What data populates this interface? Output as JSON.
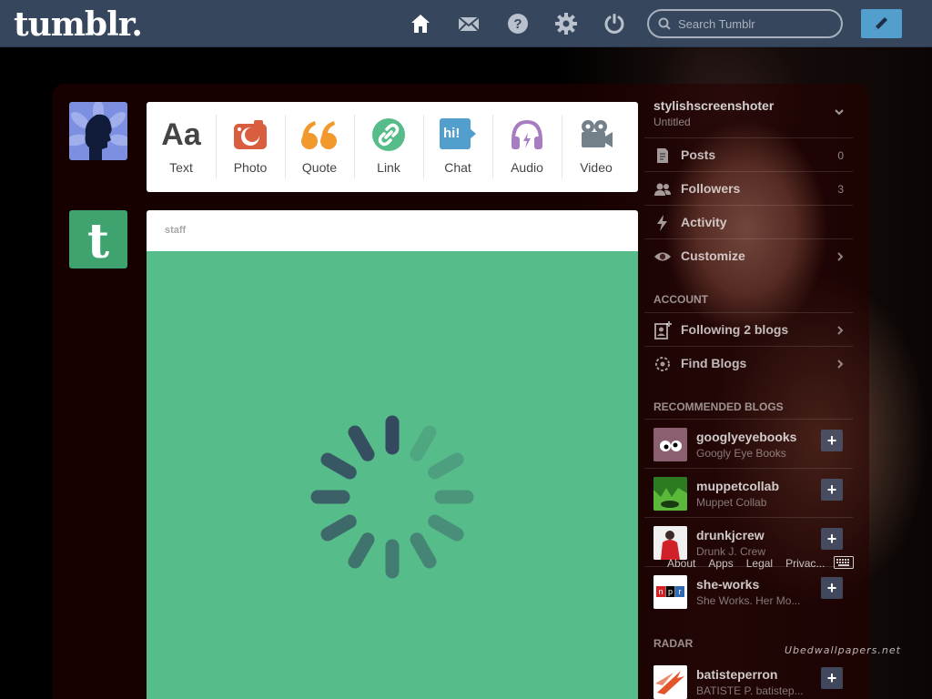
{
  "header": {
    "logo": "tumblr.",
    "search_placeholder": "Search Tumblr",
    "nav_icons": [
      "home-icon",
      "mail-icon",
      "help-icon",
      "settings-icon",
      "power-icon"
    ],
    "compose_icon": "pencil-icon"
  },
  "post_types": [
    {
      "label": "Text",
      "icon": "text-icon",
      "color": "#444444"
    },
    {
      "label": "Photo",
      "icon": "camera-icon",
      "color": "#d95e40"
    },
    {
      "label": "Quote",
      "icon": "quote-icon",
      "color": "#f2992e"
    },
    {
      "label": "Link",
      "icon": "link-icon",
      "color": "#56bc8a"
    },
    {
      "label": "Chat",
      "icon": "chat-icon",
      "color": "#529ecc"
    },
    {
      "label": "Audio",
      "icon": "headphones-icon",
      "color": "#a77dc2"
    },
    {
      "label": "Video",
      "icon": "video-camera-icon",
      "color": "#748089"
    }
  ],
  "text_icon_glyph": "Aa",
  "chat_icon_glyph": "hi!",
  "post": {
    "author": "staff",
    "media_color": "#56bc8a",
    "loading": true
  },
  "sidebar": {
    "blog_name": "stylishscreenshoter",
    "blog_title": "Untitled",
    "blog_items": [
      {
        "label": "Posts",
        "count": "0",
        "icon": "posts-icon"
      },
      {
        "label": "Followers",
        "count": "3",
        "icon": "followers-icon"
      },
      {
        "label": "Activity",
        "count": "",
        "icon": "activity-icon"
      },
      {
        "label": "Customize",
        "count": "",
        "icon": "eye-icon"
      }
    ],
    "account_heading": "ACCOUNT",
    "account_items": [
      {
        "label": "Following 2 blogs",
        "icon": "following-icon"
      },
      {
        "label": "Find Blogs",
        "icon": "find-blogs-icon"
      }
    ],
    "recommended_heading": "RECOMMENDED BLOGS",
    "recommended": [
      {
        "name": "googlyeyebooks",
        "title": "Googly Eye Books"
      },
      {
        "name": "muppetcollab",
        "title": "Muppet Collab"
      },
      {
        "name": "drunkjcrew",
        "title": "Drunk J. Crew"
      },
      {
        "name": "she-works",
        "title": "She Works. Her Mo..."
      }
    ],
    "radar_heading": "RADAR",
    "radar": {
      "name": "batisteperron",
      "title": "BATISTE P. batistep..."
    },
    "footer_links": [
      "About",
      "Apps",
      "Legal",
      "Privac..."
    ]
  },
  "watermark": "Ubedwallpapers.net"
}
